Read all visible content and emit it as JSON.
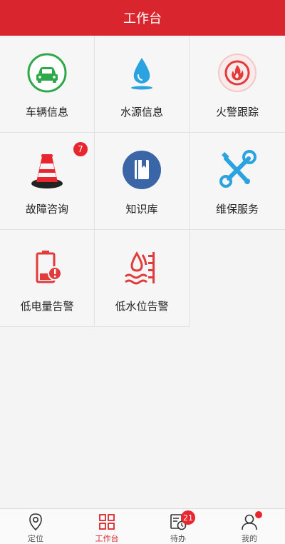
{
  "header": {
    "title": "工作台"
  },
  "tiles": [
    {
      "label": "车辆信息",
      "icon": "car-icon"
    },
    {
      "label": "水源信息",
      "icon": "water-drop-icon"
    },
    {
      "label": "火警跟踪",
      "icon": "fire-icon"
    },
    {
      "label": "故障咨询",
      "icon": "traffic-cone-icon",
      "badge": "7"
    },
    {
      "label": "知识库",
      "icon": "book-icon"
    },
    {
      "label": "维保服务",
      "icon": "tools-icon"
    },
    {
      "label": "低电量告警",
      "icon": "low-battery-icon"
    },
    {
      "label": "低水位告警",
      "icon": "low-water-icon"
    }
  ],
  "tabbar": [
    {
      "label": "定位",
      "icon": "location-pin-icon"
    },
    {
      "label": "工作台",
      "icon": "grid-icon",
      "active": true
    },
    {
      "label": "待办",
      "icon": "todo-clock-icon",
      "badge": "21"
    },
    {
      "label": "我的",
      "icon": "user-icon"
    }
  ],
  "colors": {
    "primary": "#d9262e",
    "background": "#f4f4f4"
  }
}
